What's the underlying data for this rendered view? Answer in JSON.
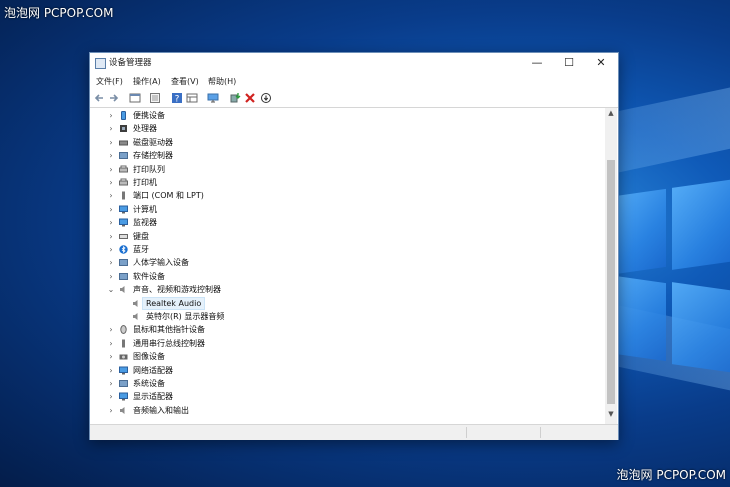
{
  "watermark": {
    "top_left": "泡泡网 PCPOP.COM",
    "bottom_right": "泡泡网 PCPOP.COM"
  },
  "window": {
    "title": "设备管理器",
    "buttons": {
      "minimize": "—",
      "maximize": "☐",
      "close": "✕"
    }
  },
  "menu": [
    "文件(F)",
    "操作(A)",
    "查看(V)",
    "帮助(H)"
  ],
  "toolbar": [
    "back-icon",
    "forward-icon",
    "properties-icon",
    "console-icon",
    "help-icon",
    "view-icon",
    "monitor-icon",
    "update-driver-icon",
    "uninstall-icon",
    "scan-icon"
  ],
  "tree": [
    {
      "label": "便携设备",
      "expanded": false,
      "icon": "portable-device-icon"
    },
    {
      "label": "处理器",
      "expanded": false,
      "icon": "processor-icon"
    },
    {
      "label": "磁盘驱动器",
      "expanded": false,
      "icon": "disk-icon"
    },
    {
      "label": "存储控制器",
      "expanded": false,
      "icon": "storage-icon"
    },
    {
      "label": "打印队列",
      "expanded": false,
      "icon": "print-queue-icon"
    },
    {
      "label": "打印机",
      "expanded": false,
      "icon": "printer-icon"
    },
    {
      "label": "端口 (COM 和 LPT)",
      "expanded": false,
      "icon": "port-icon"
    },
    {
      "label": "计算机",
      "expanded": false,
      "icon": "computer-icon"
    },
    {
      "label": "监视器",
      "expanded": false,
      "icon": "monitor-icon"
    },
    {
      "label": "键盘",
      "expanded": false,
      "icon": "keyboard-icon"
    },
    {
      "label": "蓝牙",
      "expanded": false,
      "icon": "bluetooth-icon"
    },
    {
      "label": "人体学输入设备",
      "expanded": false,
      "icon": "hid-icon"
    },
    {
      "label": "软件设备",
      "expanded": false,
      "icon": "software-device-icon"
    },
    {
      "label": "声音、视频和游戏控制器",
      "expanded": true,
      "icon": "speaker-icon",
      "children": [
        {
          "label": "Realtek Audio",
          "selected": true,
          "icon": "speaker-icon"
        },
        {
          "label": "英特尔(R) 显示器音频",
          "selected": false,
          "icon": "speaker-icon"
        }
      ]
    },
    {
      "label": "鼠标和其他指针设备",
      "expanded": false,
      "icon": "mouse-icon"
    },
    {
      "label": "通用串行总线控制器",
      "expanded": false,
      "icon": "usb-icon"
    },
    {
      "label": "图像设备",
      "expanded": false,
      "icon": "camera-icon"
    },
    {
      "label": "网络适配器",
      "expanded": false,
      "icon": "network-icon"
    },
    {
      "label": "系统设备",
      "expanded": false,
      "icon": "system-icon"
    },
    {
      "label": "显示适配器",
      "expanded": false,
      "icon": "display-adapter-icon"
    },
    {
      "label": "音频输入和输出",
      "expanded": false,
      "icon": "audio-io-icon"
    }
  ],
  "scrollbar": {
    "up": "▲",
    "down": "▼"
  },
  "colors": {
    "window_border": "#6d8fb8",
    "selection": "#e5f1fb",
    "desktop": "#0b4ea6"
  }
}
